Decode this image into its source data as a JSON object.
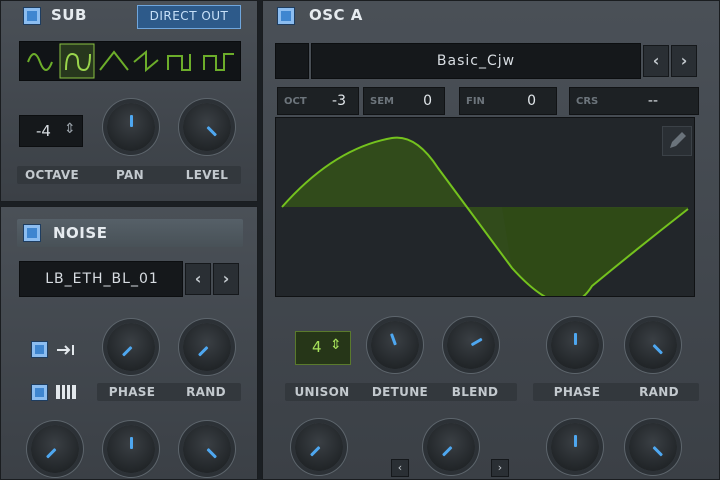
{
  "sub": {
    "title": "SUB",
    "direct_out_label": "DIRECT OUT",
    "octave_value": "-4",
    "labels": {
      "octave": "OCTAVE",
      "pan": "PAN",
      "level": "LEVEL"
    },
    "waveforms": [
      "sine",
      "rounded-square",
      "triangle",
      "saw",
      "square",
      "pulse"
    ],
    "selected_waveform": "rounded-square"
  },
  "noise": {
    "title": "NOISE",
    "preset": "LB_ETH_BL_01",
    "labels": {
      "phase": "PHASE",
      "rand": "RAND"
    }
  },
  "osc_a": {
    "title": "OSC A",
    "wavetable_name": "Basic_Cjw",
    "params": [
      {
        "name": "OCT",
        "value": "-3"
      },
      {
        "name": "SEM",
        "value": "0"
      },
      {
        "name": "FIN",
        "value": "0"
      },
      {
        "name": "CRS",
        "value": "--"
      }
    ],
    "unison_value": "4",
    "labels": {
      "unison": "UNISON",
      "detune": "DETUNE",
      "blend": "BLEND",
      "phase": "PHASE",
      "rand": "RAND"
    }
  },
  "colors": {
    "accent": "#5a9bd8",
    "wave": "#74c21e",
    "unison_text": "#a6e05a"
  },
  "icons": {
    "prev": "‹",
    "next": "›",
    "spin": "⇕",
    "pencil": "pencil-icon"
  }
}
